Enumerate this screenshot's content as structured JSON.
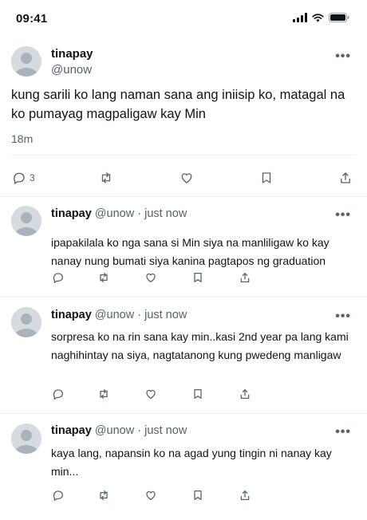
{
  "status_bar": {
    "time": "09:41"
  },
  "main_tweet": {
    "name": "tinapay",
    "handle": "@unow",
    "text": "kung sarili ko lang naman sana ang iniisip ko, matagal na ko pumayag magpaligaw kay Min",
    "time": "18m",
    "reply_count": "3"
  },
  "replies": [
    {
      "name": "tinapay",
      "handle": "@unow",
      "separator": "·",
      "time": "just now",
      "text": "ipapakilala ko nga sana si Min siya na manliligaw ko kay nanay nung bumati siya kanina pagtapos ng graduation"
    },
    {
      "name": "tinapay",
      "handle": "@unow",
      "separator": "·",
      "time": "just now",
      "text": "sorpresa ko na rin sana kay min..kasi 2nd year pa lang kami naghihintay na siya, nagtatanong kung pwedeng manligaw"
    },
    {
      "name": "tinapay",
      "handle": "@unow",
      "separator": "·",
      "time": "just now",
      "text": "kaya lang, napansin ko na agad yung tingin ni nanay kay min..."
    }
  ],
  "icons": [
    "signal-icon",
    "wifi-icon",
    "battery-icon",
    "more-icon",
    "reply-icon",
    "retweet-icon",
    "like-icon",
    "bookmark-icon",
    "share-icon"
  ],
  "colors": {
    "text": "#0f1419",
    "secondary": "#536471",
    "divider": "#eff3f4",
    "avatar": "#d6dbe1"
  }
}
